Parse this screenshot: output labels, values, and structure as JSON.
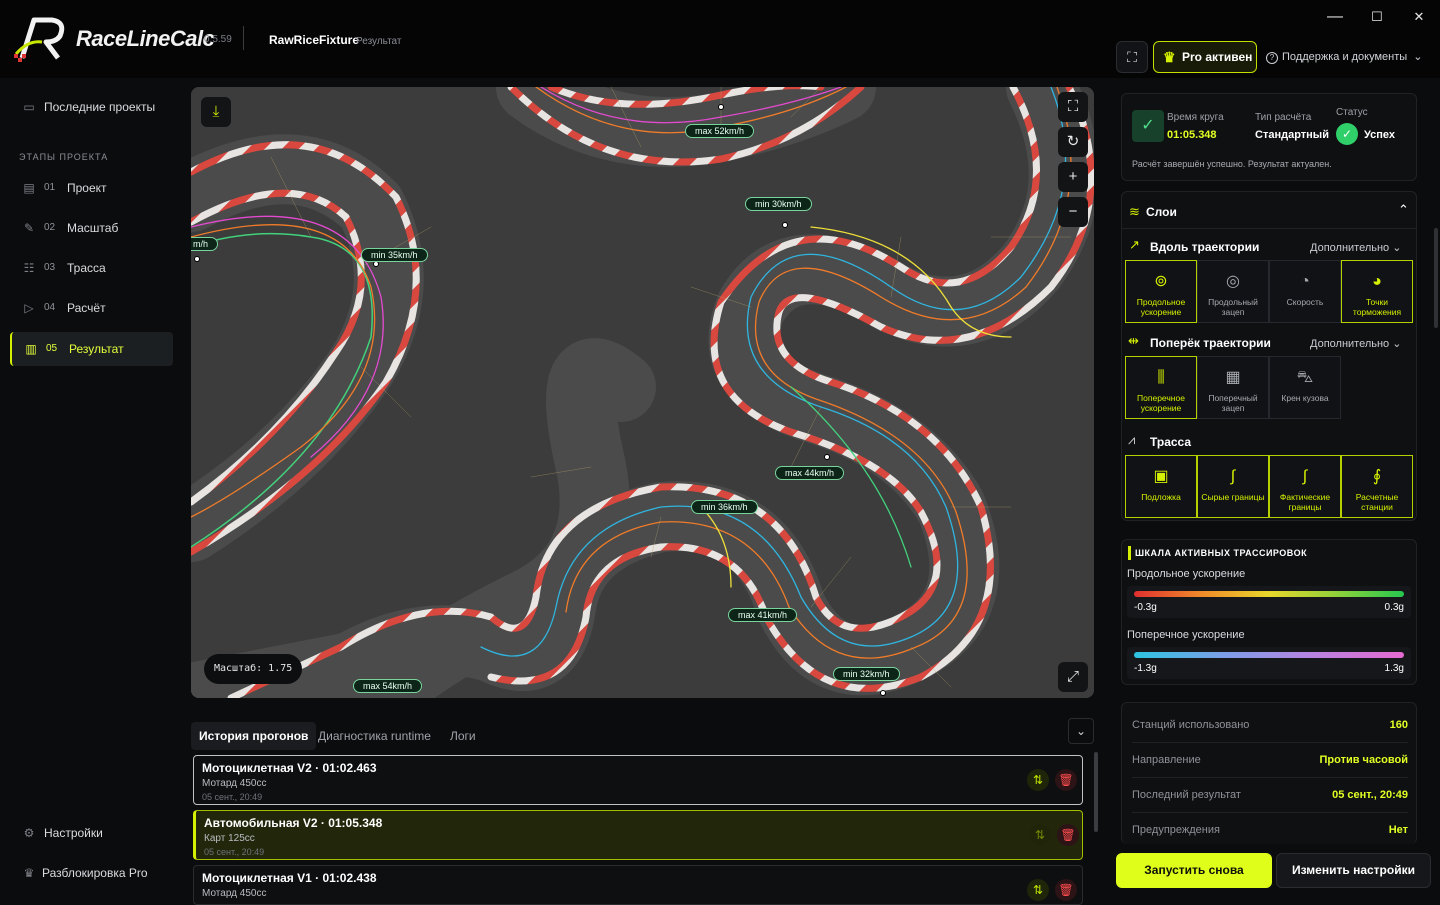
{
  "app": {
    "name": "RaceLineCalc",
    "version": "0.5.59",
    "project": "RawRiceFixture",
    "page": "Результат"
  },
  "window": {
    "minimize": "—",
    "maximize": "☐",
    "close": "✕"
  },
  "topbar": {
    "pro_label": "Pro активен",
    "support_label": "Поддержка и документы"
  },
  "sidebar": {
    "recent": "Последние проекты",
    "stages_title": "ЭТАПЫ ПРОЕКТА",
    "stages": [
      {
        "num": "01",
        "label": "Проект",
        "icon": "folder-icon"
      },
      {
        "num": "02",
        "label": "Масштаб",
        "icon": "pencil-icon"
      },
      {
        "num": "03",
        "label": "Трасса",
        "icon": "track-icon"
      },
      {
        "num": "04",
        "label": "Расчёт",
        "icon": "play-icon"
      },
      {
        "num": "05",
        "label": "Результат",
        "icon": "result-icon"
      }
    ],
    "settings": "Настройки",
    "unlock": "Разблокировка Pro"
  },
  "map": {
    "scale_text": "Масштаб: 1.75",
    "tags": [
      "max 52km/h",
      "min 30km/h",
      "m/h",
      "min 35km/h",
      "max 44km/h",
      "min 36km/h",
      "max 41km/h",
      "min 32km/h",
      "max 54km/h"
    ]
  },
  "bottom": {
    "tabs": [
      "История прогонов",
      "Диагностика runtime",
      "Логи"
    ],
    "runs": [
      {
        "title": "Мотоциклетная V2 · 01:02.463",
        "vehicle": "Мотард 450cc",
        "date": "05 сент., 20:49"
      },
      {
        "title": "Автомобильная V2 · 01:05.348",
        "vehicle": "Карт 125cc",
        "date": "05 сент., 20:49"
      },
      {
        "title": "Мотоциклетная V1 · 01:02.438",
        "vehicle": "Мотард 450cc",
        "date": ""
      }
    ]
  },
  "summary": {
    "lap_label": "Время круга",
    "lap_value": "01:05.348",
    "type_label": "Тип расчёта",
    "type_value": "Стандартный",
    "status_label": "Статус",
    "status_value": "Успех",
    "message": "Расчёт завершён успешно. Результат актуален."
  },
  "layers": {
    "title": "Слои",
    "along": {
      "title": "Вдоль траектории",
      "more": "Дополнительно",
      "items": [
        "Продольное ускорение",
        "Продольный зацеп",
        "Скорость",
        "Точки торможения"
      ]
    },
    "across": {
      "title": "Поперёк траектории",
      "more": "Дополнительно",
      "items": [
        "Поперечное ускорение",
        "Поперечный зацеп",
        "Крен кузова"
      ]
    },
    "track": {
      "title": "Трасса",
      "items": [
        "Подложка",
        "Сырые границы",
        "Фактические границы",
        "Расчетные станции"
      ]
    }
  },
  "scale": {
    "title": "ШКАЛА АКТИВНЫХ ТРАССИРОВОК",
    "long_label": "Продольное ускорение",
    "long_min": "-0.3g",
    "long_max": "0.3g",
    "lat_label": "Поперечное ускорение",
    "lat_min": "-1.3g",
    "lat_max": "1.3g"
  },
  "info": [
    {
      "k": "Станций использовано",
      "v": "160"
    },
    {
      "k": "Направление",
      "v": "Против часовой"
    },
    {
      "k": "Последний результат",
      "v": "05 сент., 20:49"
    },
    {
      "k": "Предупреждения",
      "v": "Нет"
    }
  ],
  "actions": {
    "rerun": "Запустить снова",
    "change": "Изменить настройки"
  },
  "colors": {
    "accent": "#dfff1b",
    "success": "#2fcf6a",
    "danger": "#ff4d4f"
  }
}
